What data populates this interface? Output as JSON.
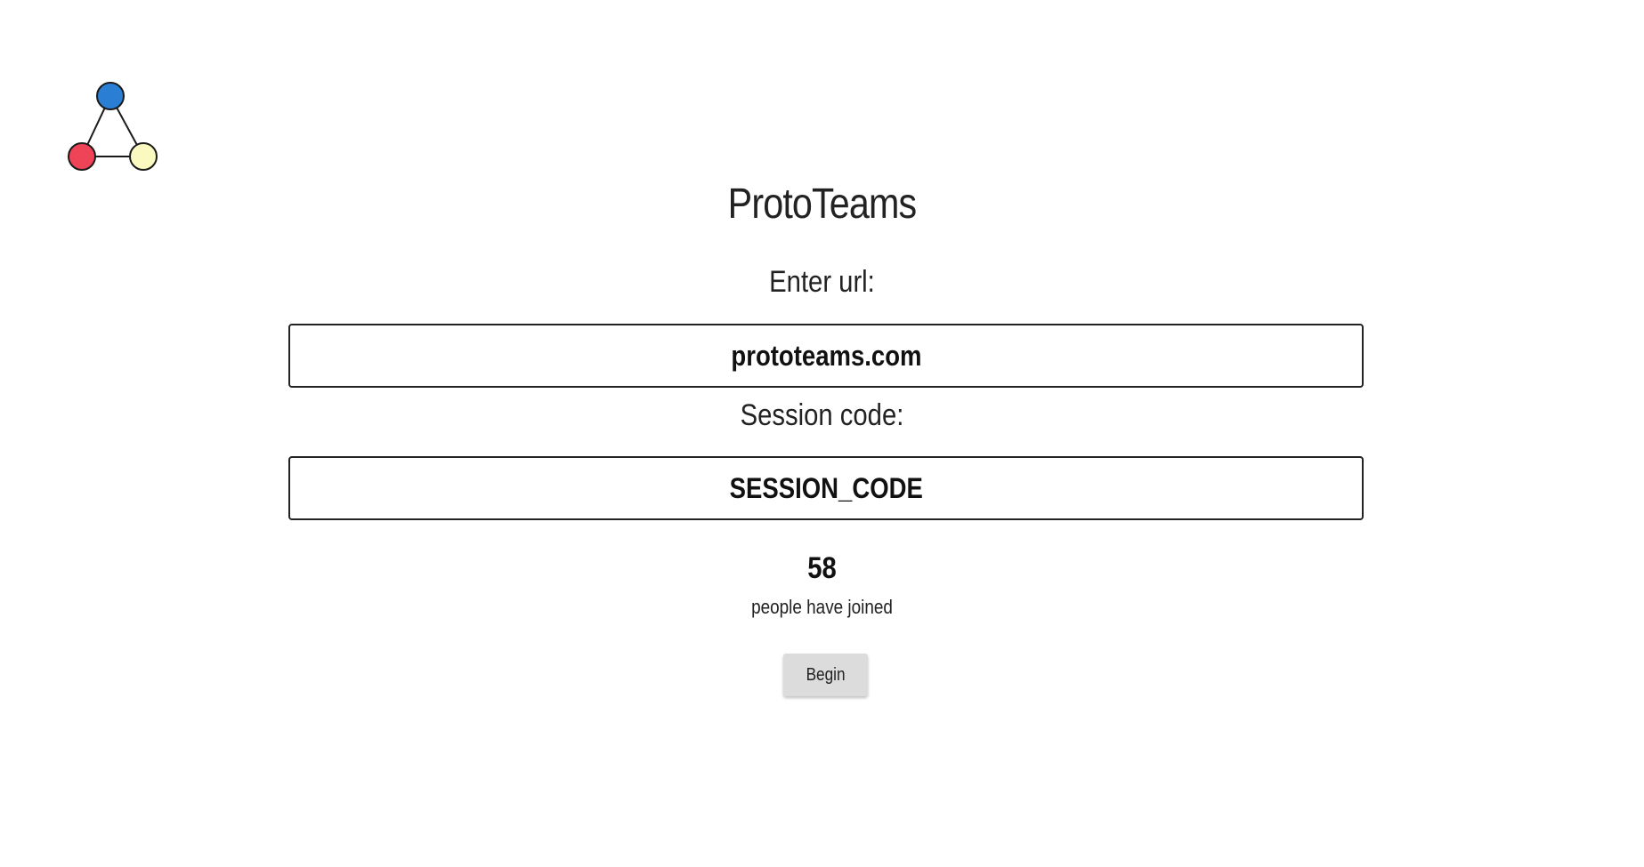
{
  "app": {
    "title": "ProtoTeams"
  },
  "logo": {
    "icon": "triangle-network-icon",
    "colors": {
      "top": "#2a7fd4",
      "left": "#ef4358",
      "right": "#fafac0",
      "stroke": "#1a1a1a"
    }
  },
  "form": {
    "url_label": "Enter url:",
    "url_value": "prototeams.com",
    "session_label": "Session code:",
    "session_value": "SESSION_CODE"
  },
  "status": {
    "count": "58",
    "joined_text": "people have joined"
  },
  "actions": {
    "begin_label": "Begin"
  }
}
